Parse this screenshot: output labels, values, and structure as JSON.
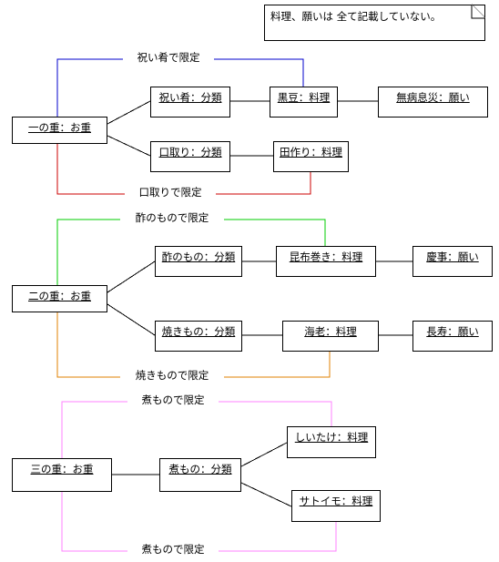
{
  "note": {
    "text": "料理、願いは 全て記載していない。"
  },
  "tiers": [
    {
      "id": "tier-1",
      "root": {
        "label": "一の重：お重"
      },
      "categories": [
        {
          "label": "祝い肴：分類"
        },
        {
          "label": "口取り：分類"
        }
      ],
      "dishes": [
        {
          "label": "黒豆：料理"
        },
        {
          "label": "田作り：料理"
        }
      ],
      "wishes": [
        {
          "label": "無病息災：願い"
        }
      ],
      "constraints": [
        {
          "label": "祝い肴で限定",
          "color": "#0000cc"
        },
        {
          "label": "口取りで限定",
          "color": "#cc0000"
        }
      ]
    },
    {
      "id": "tier-2",
      "root": {
        "label": "二の重：お重"
      },
      "categories": [
        {
          "label": "酢のもの：分類"
        },
        {
          "label": "焼きもの：分類"
        }
      ],
      "dishes": [
        {
          "label": "昆布巻き：料理"
        },
        {
          "label": "海老：料理"
        }
      ],
      "wishes": [
        {
          "label": "慶事：願い"
        },
        {
          "label": "長寿：願い"
        }
      ],
      "constraints": [
        {
          "label": "酢のもので限定",
          "color": "#00cc00"
        },
        {
          "label": "焼きもので限定",
          "color": "#e08000"
        }
      ]
    },
    {
      "id": "tier-3",
      "root": {
        "label": "三の重：お重"
      },
      "categories": [
        {
          "label": "煮もの：分類"
        }
      ],
      "dishes": [
        {
          "label": "しいたけ：料理"
        },
        {
          "label": "サトイモ：料理"
        }
      ],
      "wishes": [],
      "constraints": [
        {
          "label": "煮もので限定",
          "color": "#ff80ff"
        },
        {
          "label": "煮もので限定",
          "color": "#ff80ff"
        }
      ]
    }
  ],
  "colors": {
    "line": "#000000",
    "box_border": "#000000",
    "background": "#ffffff",
    "blue": "#0000cc",
    "red": "#cc0000",
    "green": "#00cc00",
    "orange": "#e08000",
    "pink": "#ff80ff"
  }
}
